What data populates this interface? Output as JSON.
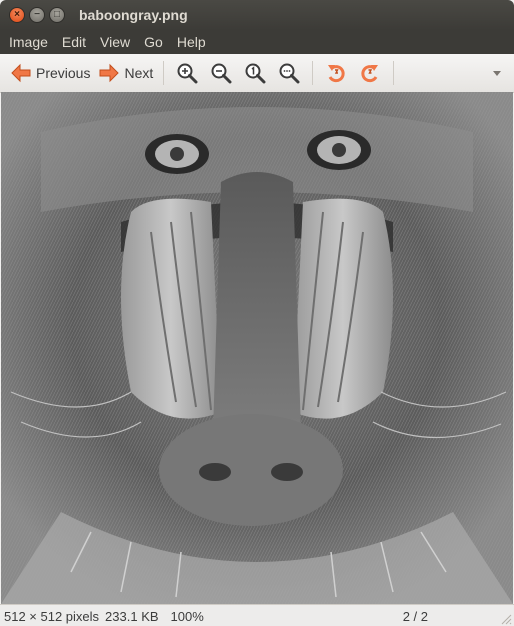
{
  "window": {
    "title": "baboongray.png",
    "buttons": {
      "close": "×",
      "minimize": "−",
      "maximize": "□"
    }
  },
  "menu": [
    "Image",
    "Edit",
    "View",
    "Go",
    "Help"
  ],
  "toolbar": {
    "previous_label": "Previous",
    "next_label": "Next",
    "icons": [
      "arrow-left-icon",
      "arrow-right-icon",
      "zoom-in-icon",
      "zoom-out-icon",
      "zoom-normal-icon",
      "zoom-fit-icon",
      "rotate-left-icon",
      "rotate-right-icon",
      "overflow-arrow-icon"
    ],
    "accent_color": "#f07746"
  },
  "image": {
    "description_icon": "grayscale-image"
  },
  "status": {
    "dimensions": "512 × 512 pixels",
    "filesize": "233.1 KB",
    "zoom": "100%",
    "page": "2 / 2"
  }
}
